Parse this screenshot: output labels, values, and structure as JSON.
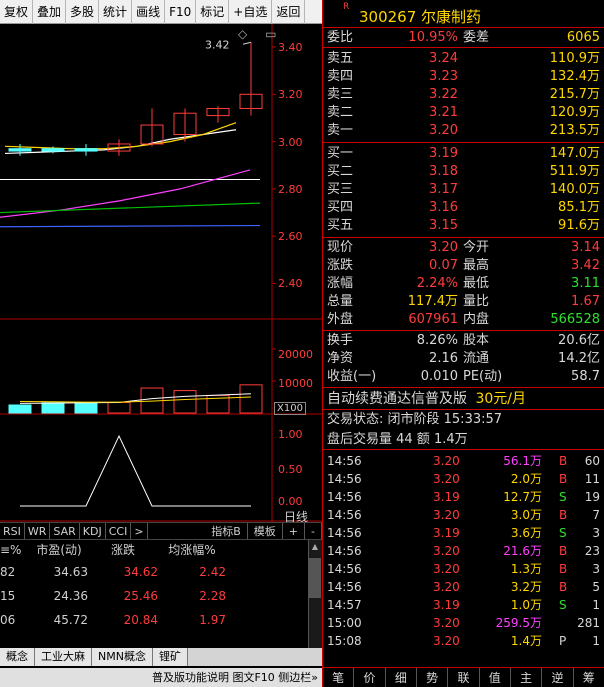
{
  "toolbar": [
    "复权",
    "叠加",
    "多股",
    "统计",
    "画线",
    "F10",
    "标记",
    "+自选",
    "返回"
  ],
  "chart": {
    "price_ticks": [
      "3.40",
      "3.20",
      "3.00",
      "2.80",
      "2.60",
      "2.40"
    ],
    "high_label": "3.42",
    "volume_ticks": [
      "20000",
      "10000"
    ],
    "volume_unit": "X100",
    "indicator_ticks": [
      "1.00",
      "0.50",
      "0.00"
    ],
    "indicator_name": "日线"
  },
  "chart_data": {
    "type": "candlestick",
    "ylim": [
      2.3,
      3.5
    ],
    "candles": [
      {
        "o": 2.97,
        "c": 2.96,
        "h": 2.99,
        "l": 2.94
      },
      {
        "o": 2.97,
        "c": 2.96,
        "h": 2.98,
        "l": 2.95
      },
      {
        "o": 2.97,
        "c": 2.96,
        "h": 2.99,
        "l": 2.94
      },
      {
        "o": 2.96,
        "c": 2.99,
        "h": 3.01,
        "l": 2.94
      },
      {
        "o": 2.99,
        "c": 3.07,
        "h": 3.14,
        "l": 2.98
      },
      {
        "o": 3.03,
        "c": 3.12,
        "h": 3.14,
        "l": 3.0
      },
      {
        "o": 3.11,
        "c": 3.14,
        "h": 3.15,
        "l": 3.08
      },
      {
        "o": 3.14,
        "c": 3.2,
        "h": 3.42,
        "l": 3.11
      }
    ],
    "volumes": [
      2500,
      3200,
      3000,
      3300,
      7800,
      7000,
      5500,
      8800
    ],
    "indicator": [
      0,
      0,
      0,
      1,
      0,
      0,
      0,
      0
    ]
  },
  "indicator_tabs": [
    "RSI",
    "WR",
    "SAR",
    "KDJ",
    "CCI",
    ">"
  ],
  "indicator_right": [
    "指标B",
    "模板",
    "+",
    "-"
  ],
  "blist": {
    "headers": [
      "≡%",
      "市盈(动)",
      "涨跌",
      "均涨幅%"
    ],
    "rows": [
      [
        "82",
        "34.63",
        "34.62",
        "2.42"
      ],
      [
        "15",
        "24.36",
        "25.46",
        "2.28"
      ],
      [
        "06",
        "45.72",
        "20.84",
        "1.97"
      ]
    ]
  },
  "block_tabs": [
    "概念",
    "工业大麻",
    "NMN概念",
    "锂矿"
  ],
  "status_text": "普及版功能说明 图文F10 侧边栏»",
  "panel": {
    "r_mark": "R",
    "code": "300267 尔康制药",
    "weibi": {
      "label": "委比",
      "value": "10.95%",
      "label2": "委差",
      "value2": "6065"
    },
    "sells": [
      {
        "label": "卖五",
        "price": "3.24",
        "vol": "110.9万"
      },
      {
        "label": "卖四",
        "price": "3.23",
        "vol": "132.4万"
      },
      {
        "label": "卖三",
        "price": "3.22",
        "vol": "215.7万"
      },
      {
        "label": "卖二",
        "price": "3.21",
        "vol": "120.9万"
      },
      {
        "label": "卖一",
        "price": "3.20",
        "vol": "213.5万"
      }
    ],
    "buys": [
      {
        "label": "买一",
        "price": "3.19",
        "vol": "147.0万"
      },
      {
        "label": "买二",
        "price": "3.18",
        "vol": "511.9万"
      },
      {
        "label": "买三",
        "price": "3.17",
        "vol": "140.0万"
      },
      {
        "label": "买四",
        "price": "3.16",
        "vol": "85.1万"
      },
      {
        "label": "买五",
        "price": "3.15",
        "vol": "91.6万"
      }
    ],
    "quote": [
      {
        "l1": "现价",
        "v1": "3.20",
        "c1": "red",
        "l2": "今开",
        "v2": "3.14",
        "c2": "red"
      },
      {
        "l1": "涨跌",
        "v1": "0.07",
        "c1": "red",
        "l2": "最高",
        "v2": "3.42",
        "c2": "red"
      },
      {
        "l1": "涨幅",
        "v1": "2.24%",
        "c1": "red",
        "l2": "最低",
        "v2": "3.11",
        "c2": "green"
      },
      {
        "l1": "总量",
        "v1": "117.4万",
        "c1": "yellow",
        "l2": "量比",
        "v2": "1.67",
        "c2": "red"
      },
      {
        "l1": "外盘",
        "v1": "607961",
        "c1": "red",
        "l2": "内盘",
        "v2": "566528",
        "c2": "green"
      }
    ],
    "fund": [
      {
        "l1": "换手",
        "v1": "8.26%",
        "l2": "股本",
        "v2": "20.6亿"
      },
      {
        "l1": "净资",
        "v1": "2.16",
        "l2": "流通",
        "v2": "14.2亿"
      },
      {
        "l1": "收益(一)",
        "v1": "0.010",
        "l2": "PE(动)",
        "v2": "58.7"
      }
    ],
    "ad_text": "自动续费通达信普及版",
    "ad_price": "30元/月",
    "trade_state": "交易状态: 闭市阶段 15:33:57",
    "after_hours": "盘后交易量 44 额 1.4万",
    "ticks": [
      {
        "t": "14:56",
        "p": "3.20",
        "v": "56.1万",
        "vc": "magenta",
        "d": "B",
        "n": "60"
      },
      {
        "t": "14:56",
        "p": "3.20",
        "v": "2.0万",
        "vc": "yellow",
        "d": "B",
        "n": "11"
      },
      {
        "t": "14:56",
        "p": "3.19",
        "v": "12.7万",
        "vc": "yellow",
        "d": "S",
        "n": "19"
      },
      {
        "t": "14:56",
        "p": "3.20",
        "v": "3.0万",
        "vc": "yellow",
        "d": "B",
        "n": "7"
      },
      {
        "t": "14:56",
        "p": "3.19",
        "v": "3.6万",
        "vc": "yellow",
        "d": "S",
        "n": "3"
      },
      {
        "t": "14:56",
        "p": "3.20",
        "v": "21.6万",
        "vc": "magenta",
        "d": "B",
        "n": "23"
      },
      {
        "t": "14:56",
        "p": "3.20",
        "v": "1.3万",
        "vc": "yellow",
        "d": "B",
        "n": "3"
      },
      {
        "t": "14:56",
        "p": "3.20",
        "v": "3.2万",
        "vc": "yellow",
        "d": "B",
        "n": "5"
      },
      {
        "t": "14:57",
        "p": "3.19",
        "v": "1.0万",
        "vc": "yellow",
        "d": "S",
        "n": "1"
      },
      {
        "t": "15:00",
        "p": "3.20",
        "v": "259.5万",
        "vc": "magenta",
        "d": "",
        "n": "281"
      },
      {
        "t": "15:08",
        "p": "3.20",
        "v": "1.4万",
        "vc": "yellow",
        "d": "P",
        "n": "1"
      }
    ],
    "bottom_tabs": [
      "笔",
      "价",
      "细",
      "势",
      "联",
      "值",
      "主",
      "逆",
      "筹"
    ]
  }
}
